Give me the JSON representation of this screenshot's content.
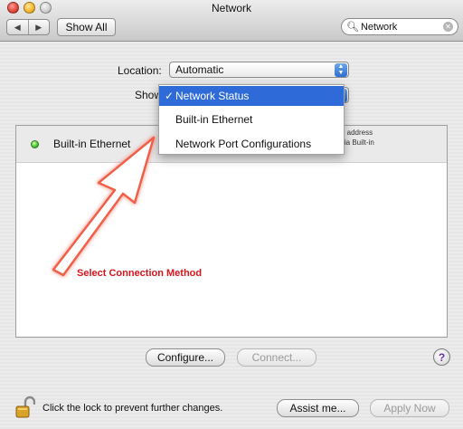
{
  "window": {
    "title": "Network"
  },
  "toolbar": {
    "back_icon": "back-arrow-icon",
    "forward_icon": "forward-arrow-icon",
    "show_all_label": "Show All",
    "search_value": "Network"
  },
  "location": {
    "label": "Location:",
    "value": "Automatic"
  },
  "show": {
    "label": "Show",
    "menu": [
      {
        "label": "Network Status",
        "checked": true
      },
      {
        "label": "Built-in Ethernet",
        "checked": false
      },
      {
        "label": "Network Port Configurations",
        "checked": false
      }
    ]
  },
  "services": [
    {
      "name": "Built-in Ethernet",
      "status_color": "#42c12a",
      "description_partial": "IP address\n net via Built-in\nEthernet."
    }
  ],
  "annotation": {
    "text": "Select Connection Method",
    "color": "#d5161c"
  },
  "buttons": {
    "configure": "Configure...",
    "connect": "Connect...",
    "help": "?",
    "assist": "Assist me...",
    "apply": "Apply Now"
  },
  "lock": {
    "message": "Click the lock to prevent further changes."
  },
  "colors": {
    "selection": "#2f6ad9",
    "status_green": "#42c12a",
    "annotation_red": "#d5161c"
  }
}
